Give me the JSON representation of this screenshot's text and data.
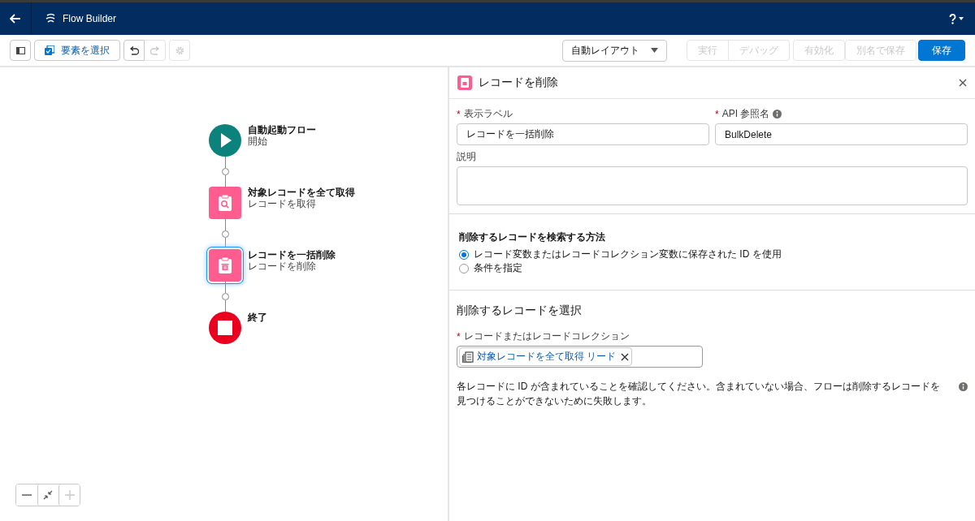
{
  "header": {
    "title": "Flow Builder"
  },
  "toolbar": {
    "select_button": "要素を選択",
    "undo_disabled": false,
    "redo_disabled": true,
    "settings_disabled": true,
    "layout_dropdown": "自動レイアウト",
    "buttons": [
      {
        "label": "実行",
        "disabled": true,
        "primary": false
      },
      {
        "label": "デバッグ",
        "disabled": true,
        "primary": false
      },
      {
        "label": "有効化",
        "disabled": true,
        "primary": false
      },
      {
        "label": "別名で保存",
        "disabled": true,
        "primary": false
      },
      {
        "label": "保存",
        "disabled": false,
        "primary": true
      }
    ]
  },
  "canvas": {
    "nodes": [
      {
        "kind": "start",
        "title": "自動起動フロー",
        "subtitle": "開始",
        "selected": false
      },
      {
        "kind": "get-records",
        "title": "対象レコードを全て取得",
        "subtitle": "レコードを取得",
        "selected": false
      },
      {
        "kind": "delete-records",
        "title": "レコードを一括削除",
        "subtitle": "レコードを削除",
        "selected": true
      },
      {
        "kind": "end",
        "title": "終了",
        "selected": false
      }
    ],
    "zoom_controls": [
      {
        "kind": "zoom-out",
        "disabled": false
      },
      {
        "kind": "fit",
        "disabled": false
      },
      {
        "kind": "zoom-in",
        "disabled": true
      }
    ]
  },
  "panel": {
    "title": "レコードを削除",
    "label_field": {
      "label": "表示ラベル",
      "required": true,
      "required_mark": "*",
      "value": "レコードを一括削除"
    },
    "api_field": {
      "label": "API 参照名",
      "required": true,
      "required_mark": "*",
      "value": "BulkDelete"
    },
    "description_field": {
      "label": "説明"
    },
    "method": {
      "heading": "削除するレコードを検索する方法",
      "options": [
        {
          "label": "レコード変数またはレコードコレクション変数に保存された ID を使用",
          "selected": true
        },
        {
          "label": "条件を指定",
          "selected": false
        }
      ]
    },
    "select_section": {
      "heading": "削除するレコードを選択",
      "field_label": "レコードまたはレコードコレクション",
      "required": true,
      "required_mark": "*",
      "pill": "対象レコードを全て取得 リード",
      "note": "各レコードに ID が含まれていることを確認してください。含まれていない場合、フローは削除するレコードを見つけることができないために失敗します。"
    }
  }
}
